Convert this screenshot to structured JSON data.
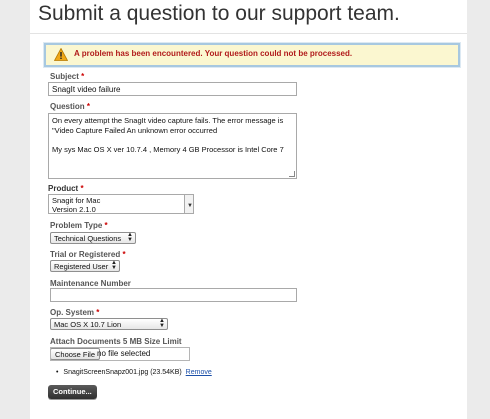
{
  "page": {
    "title": "Submit a question to our support team."
  },
  "alert": {
    "icon": "warning-icon",
    "message": "A problem has been encountered. Your question could not be processed."
  },
  "form": {
    "required_mark": "*",
    "subject": {
      "label": "Subject",
      "value": "SnagIt video failure"
    },
    "question": {
      "label": "Question",
      "lines": [
        "On every attempt the SnagIt video capture fails. The error message is",
        "\"Video Capture Failed An unknown error occurred",
        "",
        "My sys Mac OS X ver 10.7.4 , Memory 4 GB Processor  is Intel Core 7"
      ]
    },
    "product": {
      "label": "Product",
      "selected_line1": "Snagit for Mac",
      "selected_line2": "Version 2.1.0"
    },
    "problem_type": {
      "label": "Problem Type",
      "selected": "Technical Questions"
    },
    "trial_or_registered": {
      "label": "Trial or Registered",
      "selected": "Registered User"
    },
    "maintenance_number": {
      "label": "Maintenance Number",
      "value": ""
    },
    "op_system": {
      "label": "Op. System",
      "selected": "Mac OS X 10.7 Lion"
    },
    "attach": {
      "label": "Attach Documents 5 MB Size Limit",
      "button_label": "Choose File",
      "status": "no file selected",
      "attached_file": "SnagitScreenSnapz001.jpg (23.54KB)",
      "remove_label": "Remove"
    },
    "continue_label": "Continue..."
  }
}
